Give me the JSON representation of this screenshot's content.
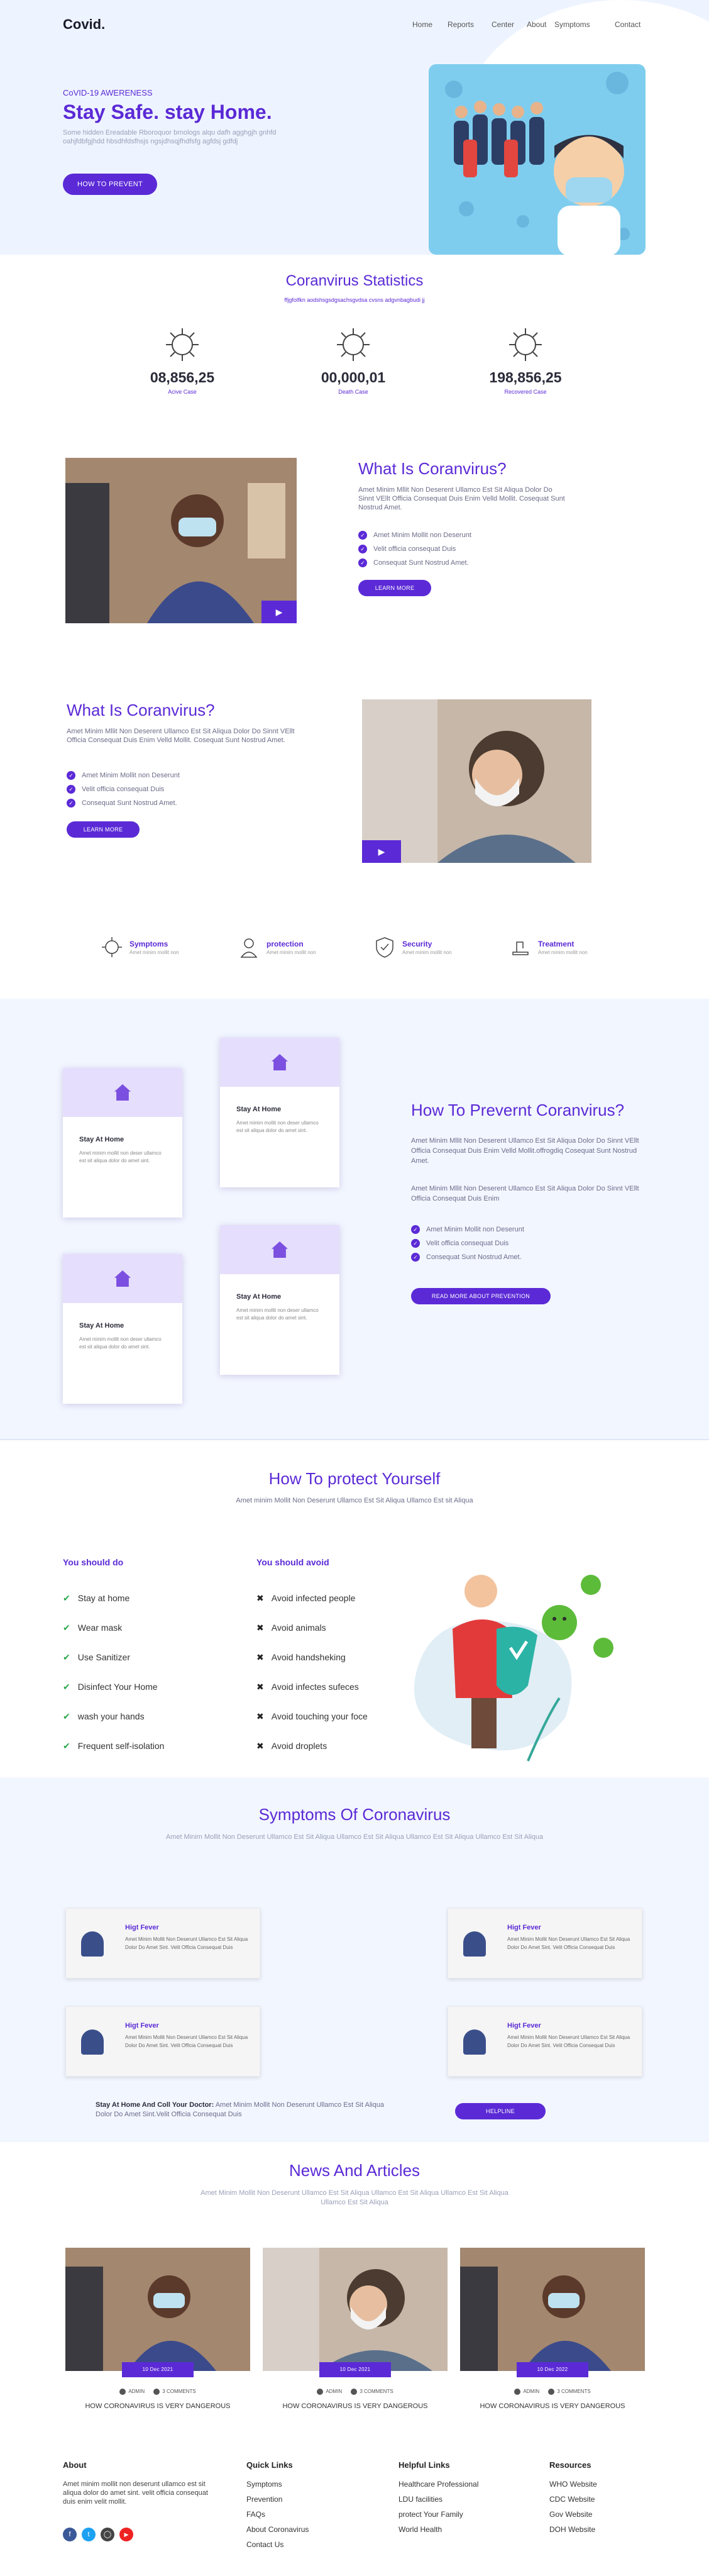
{
  "brand": {
    "logo": "Covid."
  },
  "nav": [
    "Home",
    "Reports",
    "Center",
    "About",
    "Symptoms",
    "Contact"
  ],
  "hero": {
    "eyebrow": "CoVID-19 AWERENESS",
    "title": "Stay Safe. stay Home.",
    "body": "Some hidden Ereadable Rboroquor brnologs alqu dafh agghgjh gnhfd oahjfdbfgjhdd hbsdhfdsfhsjs ngsjdhsqjfhdfsfg agfdsj gdfdj",
    "button": "HOW TO PREVENT"
  },
  "stats": {
    "title": "Coranvirus Statistics",
    "subtitle": "ffjgfolfkn aodshsgsdgsachsgvdsa cvsns adgvnbagbudi jj",
    "items": [
      {
        "value": "08,856,25",
        "label": "Acive Case"
      },
      {
        "value": "00,000,01",
        "label": "Death Case"
      },
      {
        "value": "198,856,25",
        "label": "Recovered Case"
      }
    ]
  },
  "about1": {
    "title": "What Is Coranvirus?",
    "body": "Amet Minim Mllit Non Deserent Ullamco Est Sit Aliqua Dolor Do Sinnt VEllt Officia Consequat Duis Enim Velld Mollit. Cosequat Sunt Nostrud Amet.",
    "items": [
      "Amet Minim Mollit non Deserunt",
      "Velit officia consequat Duis",
      "Consequat Sunt Nostrud Amet."
    ],
    "button": "LEARN MORE"
  },
  "about2": {
    "title": "What Is Coranvirus?",
    "body": "Amet Minim Mllit Non Deserent Ullamco Est Sit Aliqua Dolor Do Sinnt VEllt Officia Consequat Duis Enim Velld Mollit. Cosequat Sunt Nostrud Amet.",
    "items": [
      "Amet Minim Mollit non Deserunt",
      "Velit officia consequat Duis",
      "Consequat Sunt Nostrud Amet."
    ],
    "button": "LEARN MORE"
  },
  "features": [
    {
      "title": "Symptoms",
      "desc": "Amet minim mollit non"
    },
    {
      "title": "protection",
      "desc": "Amet minim mollit non"
    },
    {
      "title": "Security",
      "desc": "Amet minim mollit non"
    },
    {
      "title": "Treatment",
      "desc": "Amet minim mollit non"
    }
  ],
  "prevent": {
    "title": "How To Prevernt Coranvirus?",
    "p1": "Amet Minim Mllit Non Deserent Ullamco Est Sit Aliqua Dolor Do Sinnt VEllt Officia Consequat Duis Enim Velld Mollit.offrogdiq Cosequat Sunt Nostrud Amet.",
    "p2": "Amet Minim Mllit Non Deserent Ullamco Est Sit Aliqua Dolor Do Sinnt VEllt Officia Consequat Duis Enim",
    "items": [
      "Amet Minim Mollit non Deserunt",
      "Velit officia consequat Duis",
      "Consequat Sunt Nostrud Amet."
    ],
    "button": "READ MORE ABOUT PREVENTION",
    "card_title": "Stay At Home",
    "card_text": "Amet minim mollit non deser ullamco est sit aliqua dolor do amet sint."
  },
  "protect": {
    "title": "How To protect Yourself",
    "subtitle": "Amet minim Mollit Non Deserunt Ullamco Est Sit Aliqua Ullamco Est sit Aliqua",
    "do_title": "You should do",
    "do": [
      "Stay at home",
      "Wear mask",
      "Use Sanitizer",
      "Disinfect Your Home",
      "wash your hands",
      "Frequent self-isolation"
    ],
    "avoid_title": "You should avoid",
    "avoid": [
      "Avoid infected people",
      "Avoid animals",
      "Avoid handsheking",
      "Avoid infectes sufeces",
      "Avoid touching your foce",
      "Avoid droplets"
    ]
  },
  "symptoms": {
    "title": "Symptoms Of Coronavirus",
    "subtitle": "Amet Minim Mollit Non Deserunt Ullamco Est Sit Aliqua Ullamco Est Sit Aliqua Ullamco Est Sit Aliqua Ullamco Est Sit Aliqua",
    "card_title": "Higt Fever",
    "card_text": "Amet Minim Mollit Non Deserunt Ullamco Est Sit Aliqua Dolor Do Amet Sint. Velit Officia Consequat Duis",
    "cta_bold": "Stay At Home And Coll Your Doctor:",
    "cta_text": "Amet Minim Mollit Non Deserunt Ullamco Est Sit Aliqua Dolor Do Amet Sint.Velit Officia Consequat Duis",
    "cta_button": "HELPLINE"
  },
  "news": {
    "title": "News And Articles",
    "subtitle": "Amet Minim Mollit Non Deserunt Ullamco Est Sit Aliqua Ullamco Est Sit Aliqua Ullamco Est Sit Aliqua Ullamco Est Sit Aliqua",
    "items": [
      {
        "date": "10 Dec 2021",
        "author": "ADMIN",
        "comments": "3 COMMENTS",
        "headline": "HOW CORONAVIRUS IS VERY DANGEROUS"
      },
      {
        "date": "10 Dec 2021",
        "author": "ADMIN",
        "comments": "3 COMMENTS",
        "headline": "HOW CORONAVIRUS IS VERY DANGEROUS"
      },
      {
        "date": "10 Dec 2022",
        "author": "ADMIN",
        "comments": "3 COMMENTS",
        "headline": "HOW CORONAVIRUS IS VERY DANGEROUS"
      }
    ]
  },
  "footer": {
    "about_title": "About",
    "about_text": "Amet minim mollit non deserunt ullamco est sit aliqua dolor do amet sint. velit officia consequat duis enim velit mollit.",
    "cols": [
      {
        "title": "Quick Links",
        "links": [
          "Symptoms",
          "Prevention",
          "FAQs",
          "About Coronavirus",
          "Contact Us"
        ]
      },
      {
        "title": "Helpful Links",
        "links": [
          "Healthcare Professional",
          "LDU facilities",
          "protect Your Family",
          "World Health"
        ]
      },
      {
        "title": "Resources",
        "links": [
          "WHO Website",
          "CDC Website",
          "Gov Website",
          "DOH Website"
        ]
      }
    ]
  },
  "colors": {
    "accent": "#5b2ad6",
    "hero_bg": "#eef4ff",
    "soft_bg": "#f2f6ff"
  }
}
